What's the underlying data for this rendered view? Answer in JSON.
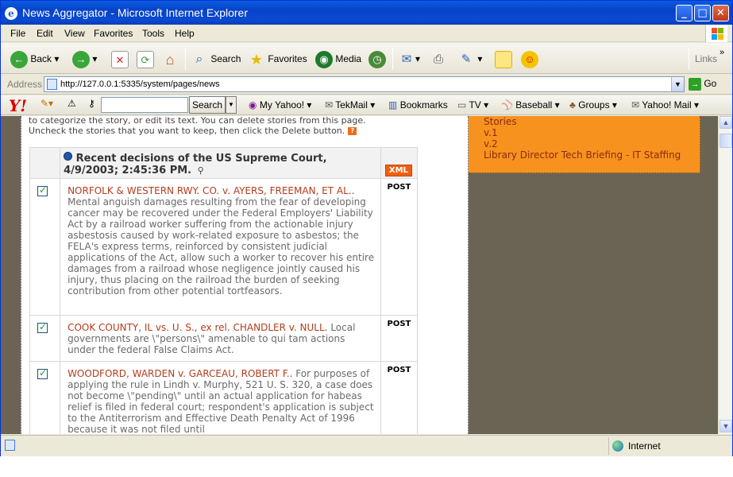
{
  "window": {
    "title": "News Aggregator - Microsoft Internet Explorer"
  },
  "menu": [
    "File",
    "Edit",
    "View",
    "Favorites",
    "Tools",
    "Help"
  ],
  "toolbar": {
    "back": "Back",
    "search": "Search",
    "favorites": "Favorites",
    "media": "Media",
    "links": "Links"
  },
  "address": {
    "label": "Address",
    "url": "http://127.0.0.1:5335/system/pages/news",
    "go": "Go"
  },
  "yahoo": {
    "logo": "Y!",
    "search_button": "Search",
    "my_yahoo": "My Yahoo!",
    "tekmail": "TekMail",
    "bookmarks": "Bookmarks",
    "tv": "TV",
    "baseball": "Baseball",
    "groups": "Groups",
    "yahoo_mail": "Yahoo! Mail"
  },
  "page": {
    "intro_line1": "to categorize the story, or edit its text. You can delete stories from this page.",
    "intro_line2": "Uncheck the stories that you want to keep, then click the Delete button.",
    "help_icon": "?",
    "channel_title": "Recent decisions of the US Supreme Court, 4/9/2003; 2:45:36 PM.",
    "xml_badge": "XML",
    "stories": [
      {
        "checked": true,
        "title": "NORFOLK & WESTERN RWY. CO. v. AYERS, FREEMAN, ET AL..",
        "body": "Mental anguish damages resulting from the fear of developing cancer may be recovered under the Federal Employers' Liability Act by a railroad worker suffering from the actionable injury asbestosis caused by work-related exposure to asbestos; the FELA's express terms, reinforced by consistent judicial applications of the Act, allow such a worker to recover his entire damages from a railroad whose negligence jointly caused his injury, thus placing on the railroad the burden of seeking contribution from other potential tortfeasors.",
        "action": "POST"
      },
      {
        "checked": true,
        "title": "COOK COUNTY, IL vs. U. S., ex rel. CHANDLER v. NULL.",
        "body": "Local governments are \\\"persons\\\" amenable to qui tam actions under the federal False Claims Act.",
        "action": "POST"
      },
      {
        "checked": true,
        "title": "WOODFORD, WARDEN v. GARCEAU, ROBERT F..",
        "body": "For purposes of applying the rule in Lindh v. Murphy, 521 U. S. 320, a case does not become \\\"pending\\\" until an actual application for habeas relief is filed in federal court; respondent's application is subject to the Antiterrorism and Effective Death Penalty Act of 1996 because it was not filed until",
        "action": "POST"
      }
    ]
  },
  "sidebar": {
    "items": [
      "Stories",
      "v.1",
      "v.2",
      "Library Director Tech Briefing - IT Staffing"
    ]
  },
  "status": {
    "zone": "Internet"
  }
}
